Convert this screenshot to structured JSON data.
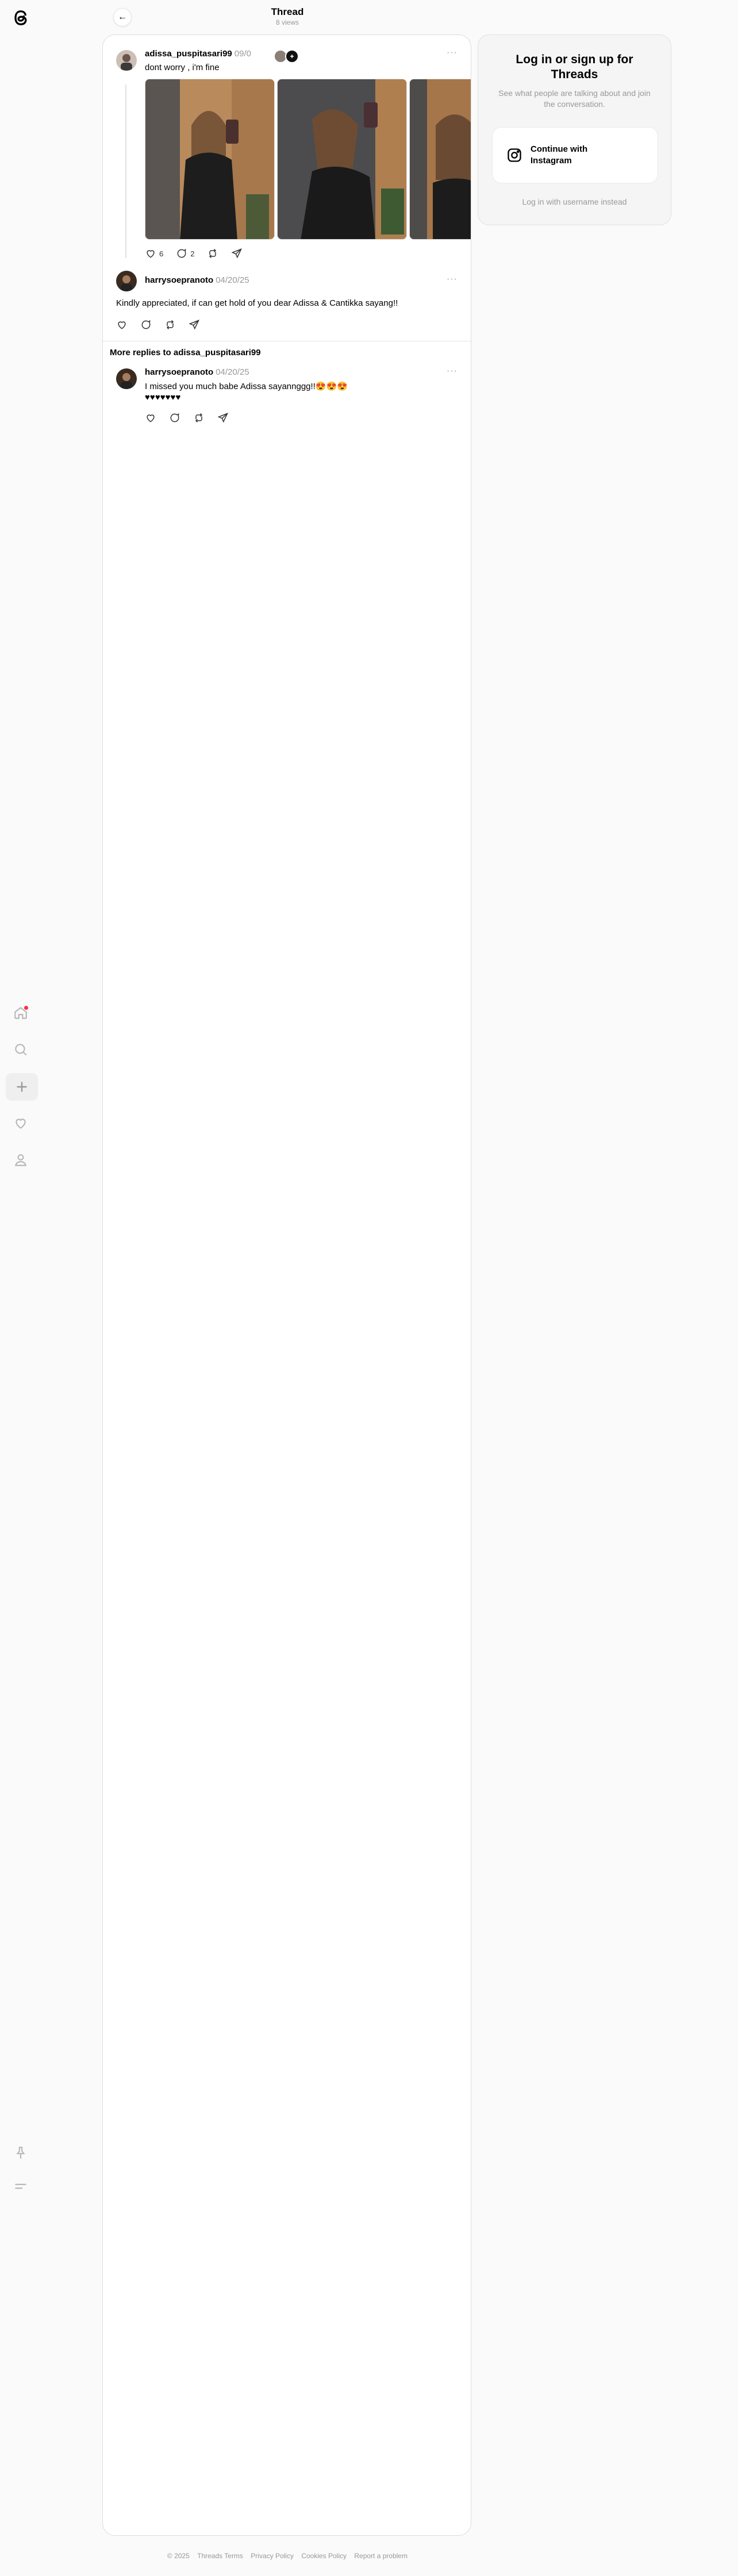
{
  "header": {
    "title": "Thread",
    "views": "8 views"
  },
  "sidebar": {
    "items": [
      {
        "name": "home-icon"
      },
      {
        "name": "search-icon"
      },
      {
        "name": "plus-icon"
      },
      {
        "name": "heart-icon"
      },
      {
        "name": "profile-icon"
      },
      {
        "name": "pin-icon"
      },
      {
        "name": "menu-icon"
      }
    ]
  },
  "post": {
    "username": "adissa_puspitasari99",
    "date": "09/0",
    "text": "dont worry , i'm fine",
    "likes": "6",
    "comments": "2"
  },
  "reply1": {
    "username": "harrysoepranoto",
    "date": "04/20/25",
    "text": "Kindly appreciated, if can get hold of you dear Adissa & Cantikka sayang!!"
  },
  "more_replies": {
    "title": "More replies to adissa_puspitasari99"
  },
  "reply2": {
    "username": "harrysoepranoto",
    "date": "04/20/25",
    "line1": "I missed you much babe Adissa sayannggg!!😍😍😍",
    "line2": "♥♥♥♥♥♥♥"
  },
  "login": {
    "title": "Log in or sign up for Threads",
    "subtitle": "See what people are talking about and join the conversation.",
    "ig_button": "Continue with Instagram",
    "alt_link": "Log in with username instead"
  },
  "footer": [
    "© 2025",
    "Threads Terms",
    "Privacy Policy",
    "Cookies Policy",
    "Report a problem"
  ],
  "colors": {
    "accent": "#000000",
    "muted": "#999999",
    "notification": "#ff3040",
    "background": "#fafafa"
  }
}
